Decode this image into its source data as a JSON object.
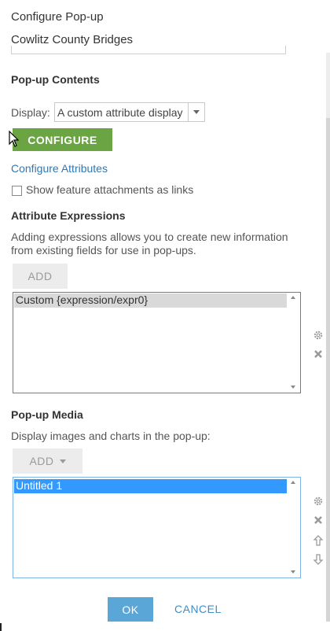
{
  "header": {
    "title": "Configure Pop-up",
    "subtitle": "Cowlitz County Bridges"
  },
  "popup_contents": {
    "heading": "Pop-up Contents",
    "display_label": "Display:",
    "display_value": "A custom attribute display",
    "configure_button": "CONFIGURE",
    "configure_attributes_link": "Configure Attributes",
    "show_attachments_label": "Show feature attachments as links",
    "show_attachments_checked": false
  },
  "attribute_expressions": {
    "heading": "Attribute Expressions",
    "description": "Adding expressions allows you to create new information from existing fields for use in pop-ups.",
    "add_button": "ADD",
    "items": [
      "Custom {expression/expr0}"
    ]
  },
  "popup_media": {
    "heading": "Pop-up Media",
    "description": "Display images and charts in the pop-up:",
    "add_button": "ADD",
    "items": [
      "Untitled 1"
    ]
  },
  "footer": {
    "ok_button": "OK",
    "cancel_button": "CANCEL"
  },
  "icons": {
    "settings": "gear-icon",
    "delete": "close-icon",
    "move_up": "arrow-up-icon",
    "move_down": "arrow-down-icon",
    "dropdown": "chevron-down-icon"
  },
  "colors": {
    "configure_button": "#6ba442",
    "ok_button": "#5aa6d6",
    "link": "#3177b0",
    "selected_item": "#3399ff"
  }
}
